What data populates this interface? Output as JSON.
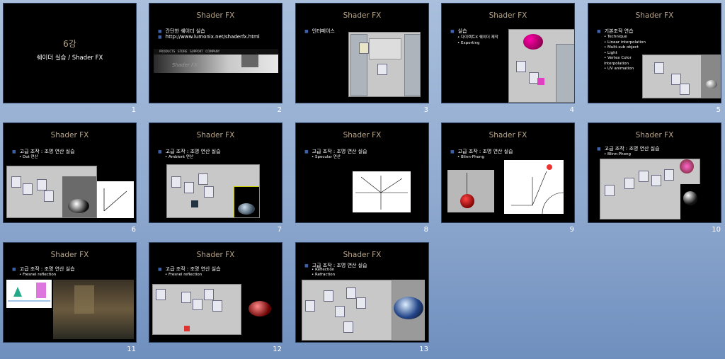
{
  "slides": [
    {
      "number": "1",
      "title": "6강",
      "subtitle": "쉐이더 실습 / Shader FX"
    },
    {
      "number": "2",
      "title": "Shader FX",
      "bullets": [
        "간단한 쉐이더 실습",
        "http://www.lumonix.net/shaderfx.html"
      ],
      "banner_text": "Shader FX",
      "banner_nav": [
        "PRODUCTS",
        "STORE",
        "SUPPORT",
        "COMPANY"
      ]
    },
    {
      "number": "3",
      "title": "Shader FX",
      "bullets": [
        "인터페이스"
      ]
    },
    {
      "number": "4",
      "title": "Shader FX",
      "bullets": [
        "실습"
      ],
      "subs": [
        "다이렉트X 쉐이더 제작",
        "Exporting"
      ]
    },
    {
      "number": "5",
      "title": "Shader FX",
      "bullets": [
        "기본조작 연습"
      ],
      "subs": [
        "Technique",
        "Linear interpolation",
        "Multi-sub object",
        "Light",
        "Vertex Color interpolation",
        "UV animation"
      ]
    },
    {
      "number": "6",
      "title": "Shader FX",
      "bullets": [
        "고급 조작 : 조명 연산 실습"
      ],
      "subs": [
        "Dot 연산"
      ]
    },
    {
      "number": "7",
      "title": "Shader FX",
      "bullets": [
        "고급 조작 : 조명 연산 실습"
      ],
      "subs": [
        "Ambient 연산"
      ]
    },
    {
      "number": "8",
      "title": "Shader FX",
      "bullets": [
        "고급 조작 : 조명 연산 실습"
      ],
      "subs": [
        "Specular 연산"
      ]
    },
    {
      "number": "9",
      "title": "Shader FX",
      "bullets": [
        "고급 조작 : 조명 연산 실습"
      ],
      "subs": [
        "Blinn-Phong"
      ]
    },
    {
      "number": "10",
      "title": "Shader FX",
      "bullets": [
        "고급 조작 : 조명 연산 실습"
      ],
      "subs": [
        "Blinn-Phong"
      ]
    },
    {
      "number": "11",
      "title": "Shader FX",
      "bullets": [
        "고급 조작 : 조명 연산 실습"
      ],
      "subs": [
        "Fresnel reflection"
      ]
    },
    {
      "number": "12",
      "title": "Shader FX",
      "bullets": [
        "고급 조작 : 조명 연산 실습"
      ],
      "subs": [
        "Fresnel reflection"
      ]
    },
    {
      "number": "13",
      "title": "Shader FX",
      "bullets": [
        "고급 조작 : 조명 연산 실습"
      ],
      "subs": [
        "Reflection",
        "Refraction"
      ]
    }
  ],
  "colors": {
    "slide_bg": "#000000",
    "title": "#b8a58a",
    "bullet": "#3c5fa8",
    "page_bg": "#8fa9cf"
  }
}
